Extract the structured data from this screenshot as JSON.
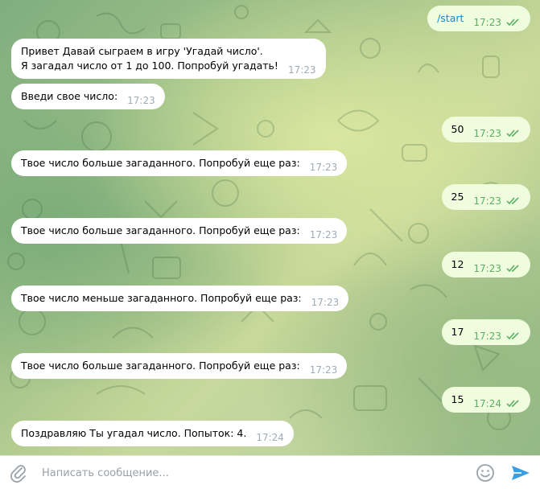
{
  "chat": {
    "messages": [
      {
        "direction": "out",
        "text": "/start",
        "time": "17:23",
        "is_command": true
      },
      {
        "direction": "in",
        "line1": "Привет Давай сыграем в игру 'Угадай число'.",
        "line2": "Я загадал число от 1 до 100. Попробуй угадать!",
        "time": "17:23"
      },
      {
        "direction": "in",
        "text": "Введи свое число:",
        "time": "17:23"
      },
      {
        "direction": "out",
        "text": "50",
        "time": "17:23"
      },
      {
        "direction": "in",
        "text": "Твое число больше загаданного. Попробуй еще раз:",
        "time": "17:23"
      },
      {
        "direction": "out",
        "text": "25",
        "time": "17:23"
      },
      {
        "direction": "in",
        "text": "Твое число больше загаданного. Попробуй еще раз:",
        "time": "17:23"
      },
      {
        "direction": "out",
        "text": "12",
        "time": "17:23"
      },
      {
        "direction": "in",
        "text": "Твое число меньше загаданного. Попробуй еще раз:",
        "time": "17:23"
      },
      {
        "direction": "out",
        "text": "17",
        "time": "17:23"
      },
      {
        "direction": "in",
        "text": "Твое число больше загаданного. Попробуй еще раз:",
        "time": "17:23"
      },
      {
        "direction": "out",
        "text": "15",
        "time": "17:24"
      },
      {
        "direction": "in",
        "text": "Поздравляю Ты угадал число. Попыток: 4.",
        "time": "17:24"
      }
    ]
  },
  "composer": {
    "placeholder": "Написать сообщение...",
    "value": ""
  },
  "colors": {
    "incoming_bubble": "#ffffff",
    "outgoing_bubble": "#effdde",
    "read_ticks": "#5fad67",
    "command_link": "#168acd",
    "send_icon": "#3a9fe0"
  },
  "icons": {
    "attach": "paperclip-icon",
    "emoji": "smile-icon",
    "send": "send-arrow-icon",
    "read": "double-check-icon"
  }
}
